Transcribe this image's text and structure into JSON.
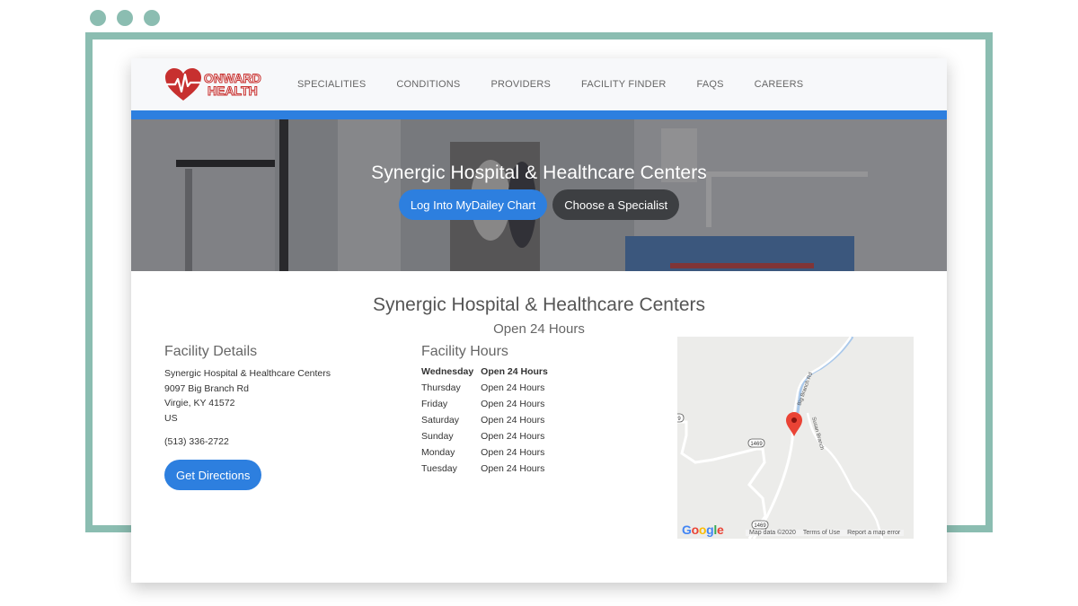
{
  "window": {
    "dots": [
      "dot-1",
      "dot-2",
      "dot-3"
    ],
    "frame_color": "#8bbdb1"
  },
  "brand": {
    "name_line1": "ONWARD",
    "name_line2": "HEALTH",
    "icon": "heart-pulse-icon",
    "color": "#c7302f"
  },
  "nav": {
    "items": [
      {
        "label": "Specialities"
      },
      {
        "label": "Conditions"
      },
      {
        "label": "Providers"
      },
      {
        "label": "Facility Finder"
      },
      {
        "label": "FAQs"
      },
      {
        "label": "Careers"
      }
    ]
  },
  "hero": {
    "title": "Synergic Hospital & Healthcare Centers",
    "primary_button": "Log Into MyDailey Chart",
    "secondary_button": "Choose a Specialist"
  },
  "main": {
    "title": "Synergic Hospital & Healthcare Centers",
    "subtitle": "Open 24 Hours"
  },
  "details": {
    "heading": "Facility Details",
    "name": "Synergic Hospital & Healthcare Centers",
    "street": "9097 Big Branch Rd",
    "city_state_zip": "Virgie, KY 41572",
    "country": "US",
    "phone": "(513) 336-2722",
    "directions_button": "Get Directions"
  },
  "hours": {
    "heading": "Facility Hours",
    "rows": [
      {
        "day": "Wednesday",
        "hours": "Open 24 Hours",
        "today": true
      },
      {
        "day": "Thursday",
        "hours": "Open 24 Hours"
      },
      {
        "day": "Friday",
        "hours": "Open 24 Hours"
      },
      {
        "day": "Saturday",
        "hours": "Open 24 Hours"
      },
      {
        "day": "Sunday",
        "hours": "Open 24 Hours"
      },
      {
        "day": "Monday",
        "hours": "Open 24 Hours"
      },
      {
        "day": "Tuesday",
        "hours": "Open 24 Hours"
      }
    ]
  },
  "map": {
    "road_labels": [
      "Big Branch Rd",
      "Susan Branch"
    ],
    "route_shields": [
      "1469",
      "1469",
      "9"
    ],
    "logo": "Google",
    "attribution": [
      "Map data ©2020",
      "Terms of Use",
      "Report a map error"
    ],
    "pin_color": "#ea4335"
  },
  "colors": {
    "accent_blue": "#2d7fdf",
    "dark_button": "#3d3f42"
  }
}
